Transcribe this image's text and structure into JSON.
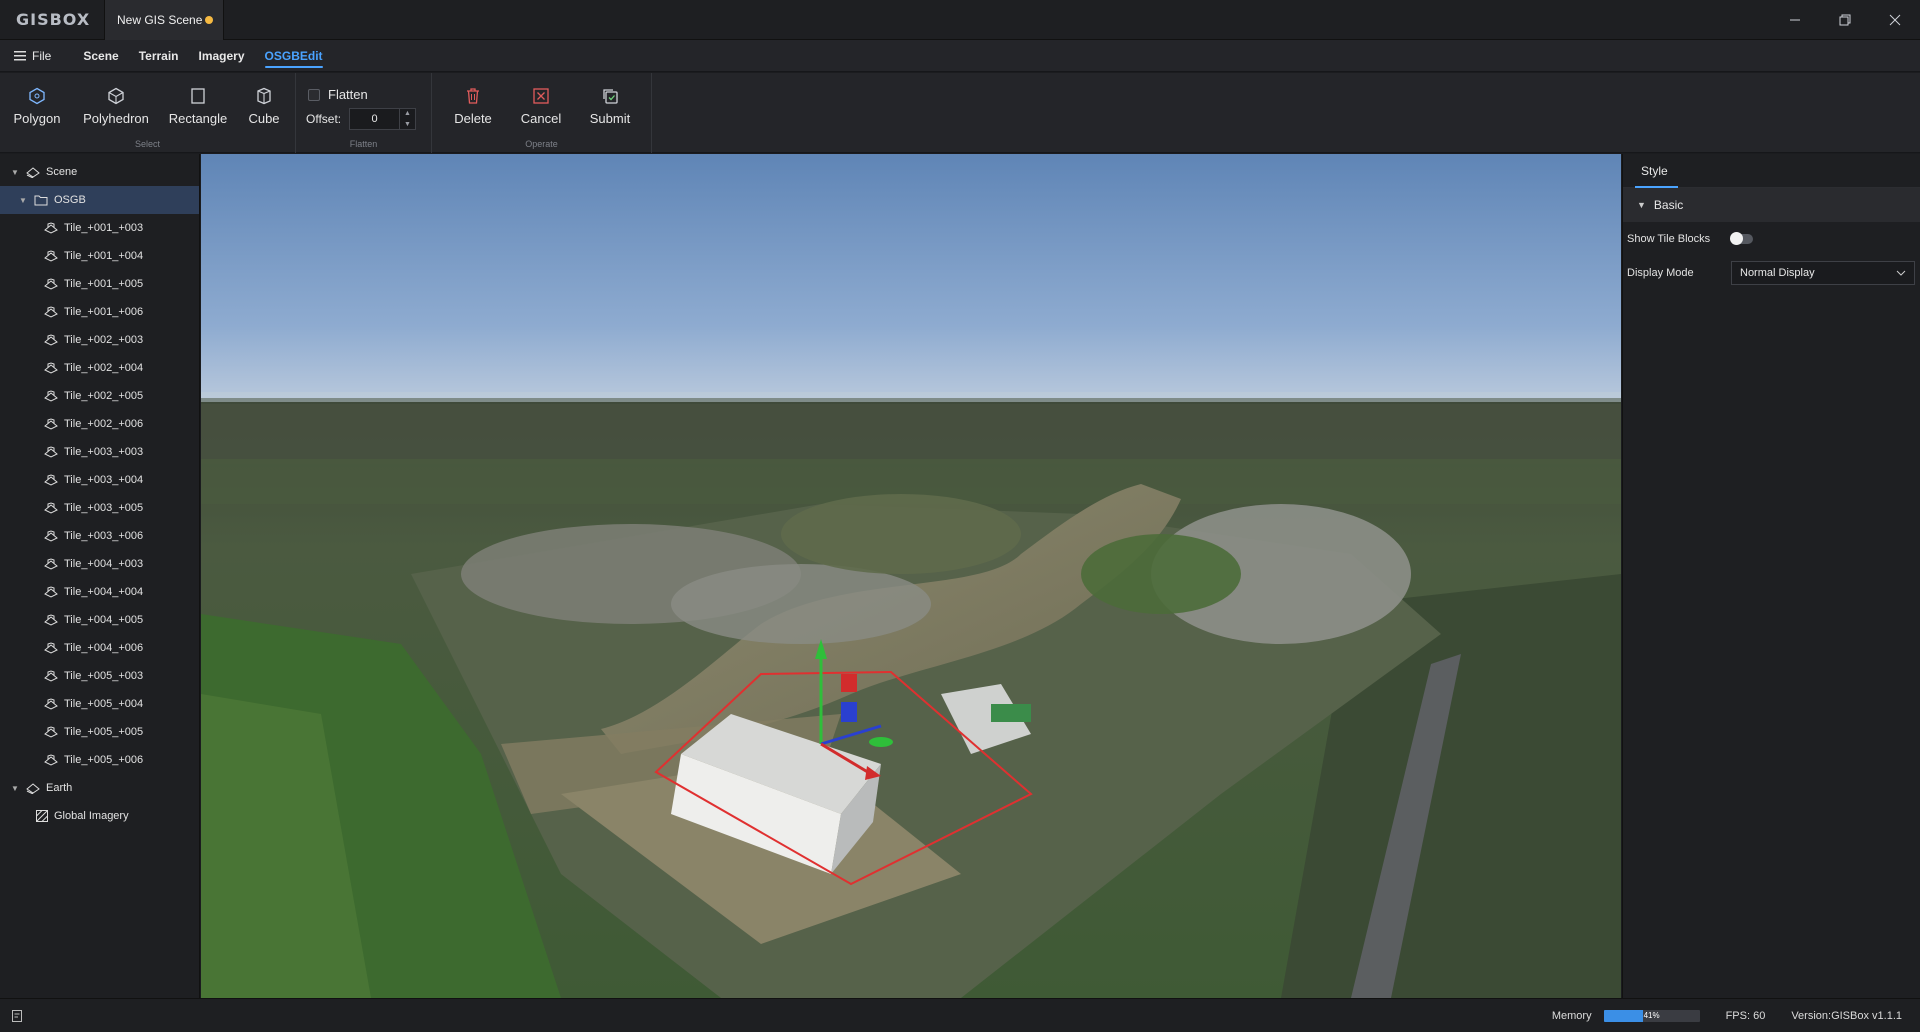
{
  "titlebar": {
    "logo": "GISBOX",
    "doc_tab": "New GIS Scene",
    "accent_unsaved": "#f5b942"
  },
  "menubar": {
    "file": "File",
    "tabs": [
      {
        "label": "Scene",
        "active": false
      },
      {
        "label": "Terrain",
        "active": false
      },
      {
        "label": "Imagery",
        "active": false
      },
      {
        "label": "OSGBEdit",
        "active": true
      }
    ]
  },
  "ribbon": {
    "select": {
      "label": "Select",
      "buttons": [
        {
          "label": "Polygon",
          "icon": "polygon-icon"
        },
        {
          "label": "Polyhedron",
          "icon": "polyhedron-icon"
        },
        {
          "label": "Rectangle",
          "icon": "rectangle-icon"
        },
        {
          "label": "Cube",
          "icon": "cube-icon"
        }
      ]
    },
    "flatten": {
      "label": "Flatten",
      "checkbox_label": "Flatten",
      "offset_label": "Offset:",
      "offset_value": "0"
    },
    "operate": {
      "label": "Operate",
      "buttons": [
        {
          "label": "Delete",
          "icon": "trash-icon"
        },
        {
          "label": "Cancel",
          "icon": "cancel-icon"
        },
        {
          "label": "Submit",
          "icon": "submit-icon"
        }
      ]
    }
  },
  "tree": {
    "scene": "Scene",
    "osgb": "OSGB",
    "tiles": [
      "Tile_+001_+003",
      "Tile_+001_+004",
      "Tile_+001_+005",
      "Tile_+001_+006",
      "Tile_+002_+003",
      "Tile_+002_+004",
      "Tile_+002_+005",
      "Tile_+002_+006",
      "Tile_+003_+003",
      "Tile_+003_+004",
      "Tile_+003_+005",
      "Tile_+003_+006",
      "Tile_+004_+003",
      "Tile_+004_+004",
      "Tile_+004_+005",
      "Tile_+004_+006",
      "Tile_+005_+003",
      "Tile_+005_+004",
      "Tile_+005_+005",
      "Tile_+005_+006"
    ],
    "earth": "Earth",
    "global_imagery": "Global Imagery"
  },
  "props": {
    "tab": "Style",
    "section": "Basic",
    "show_tile_blocks_label": "Show Tile Blocks",
    "show_tile_blocks_on": false,
    "display_mode_label": "Display Mode",
    "display_mode_value": "Normal Display"
  },
  "status": {
    "memory_label": "Memory",
    "memory_percent": 41,
    "memory_text": "41%",
    "fps": "FPS: 60",
    "version": "Version:GISBox v1.1.1"
  },
  "colors": {
    "accent": "#4aa3ff",
    "selection": "#2f3f5a"
  }
}
